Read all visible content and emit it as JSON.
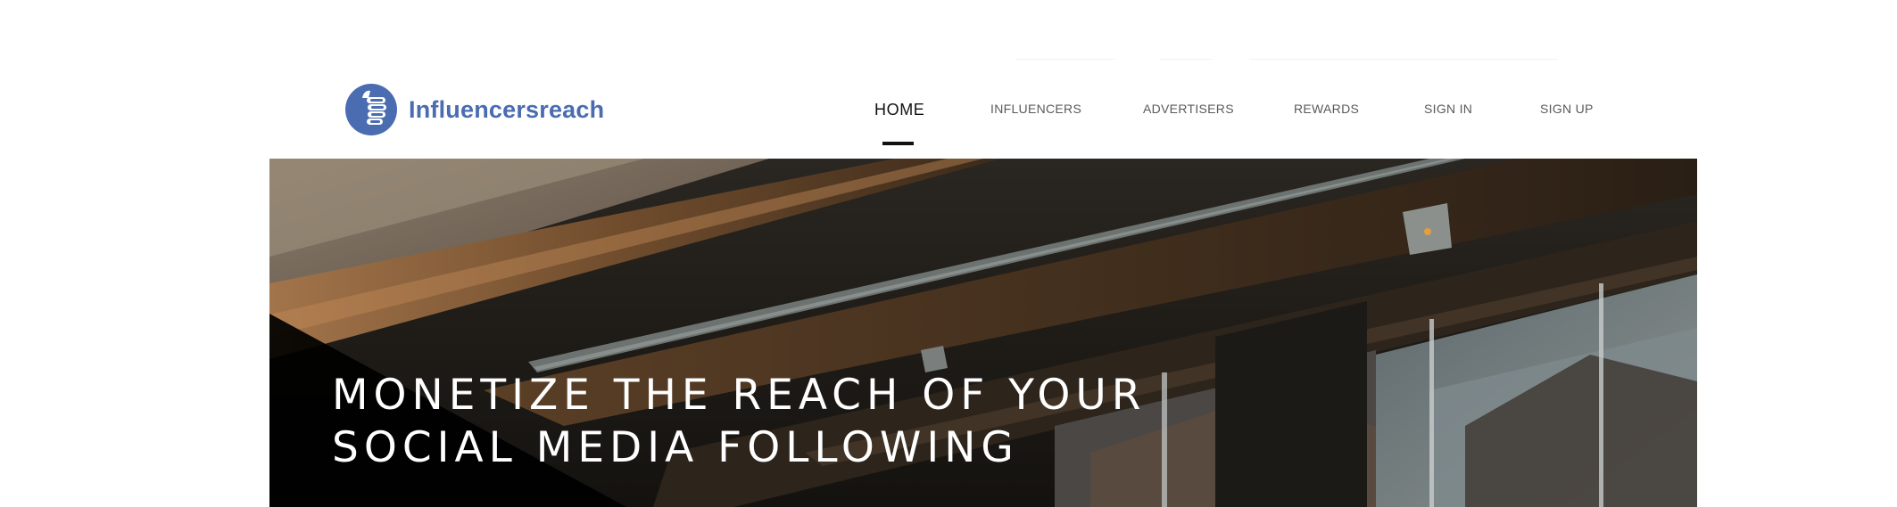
{
  "brand": {
    "name": "Influencersreach",
    "color": "#4a6cb0"
  },
  "nav": {
    "items": [
      {
        "label": "HOME",
        "active": true
      },
      {
        "label": "INFLUENCERS",
        "active": false
      },
      {
        "label": "ADVERTISERS",
        "active": false
      },
      {
        "label": "REWARDS",
        "active": false
      },
      {
        "label": "SIGN IN",
        "active": false
      },
      {
        "label": "SIGN UP",
        "active": false
      }
    ]
  },
  "hero": {
    "title_line1": "MONETIZE THE REACH OF YOUR",
    "title_line2": "SOCIAL MEDIA FOLLOWING"
  }
}
